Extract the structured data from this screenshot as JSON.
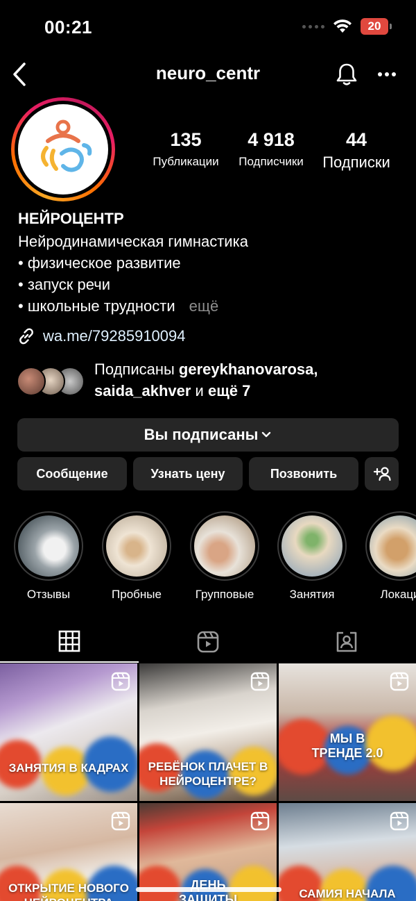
{
  "status_bar": {
    "time": "00:21",
    "battery": "20"
  },
  "header": {
    "username": "neuro_centr"
  },
  "stats": [
    {
      "value": "135",
      "label": "Публикации"
    },
    {
      "value": "4 918",
      "label": "Подписчики"
    },
    {
      "value": "44",
      "label": "Подписки"
    }
  ],
  "bio": {
    "name": "НЕЙРОЦЕНТР",
    "lines": [
      "Нейродинамическая гимнастика",
      "• физическое развитие",
      "• запуск речи",
      "• школьные трудности"
    ],
    "more": "ещё"
  },
  "link": "wa.me/79285910094",
  "followed_by": {
    "prefix": "Подписаны ",
    "user1": "gereykhanovarosa,",
    "user2": "saida_akhver",
    "middle": " и ",
    "suffix": "ещё 7"
  },
  "buttons": {
    "following": "Вы подписаны",
    "message": "Сообщение",
    "price": "Узнать цену",
    "call": "Позвонить"
  },
  "highlights": [
    {
      "label": "Отзывы"
    },
    {
      "label": "Пробные"
    },
    {
      "label": "Групповые"
    },
    {
      "label": "Занятия"
    },
    {
      "label": "Локаци"
    }
  ],
  "posts": [
    {
      "caption": "ЗАНЯТИЯ В КАДРАХ"
    },
    {
      "caption": "РЕБЁНОК ПЛАЧЕТ В НЕЙРОЦЕНТРЕ?"
    },
    {
      "caption": "МЫ В ТРЕНДЕ 2.0"
    },
    {
      "caption": "ОТКРЫТИЕ НОВОГО НЕЙРОЦЕНТРА"
    },
    {
      "caption": "ДЕНЬ ЗАЩИТЫ ДЕТЕЙ"
    },
    {
      "caption": "САМИЯ НАЧАЛА"
    }
  ],
  "colors": {
    "accent_red": "#e0483e",
    "button_bg": "#262626",
    "link": "#e0f1ff"
  }
}
